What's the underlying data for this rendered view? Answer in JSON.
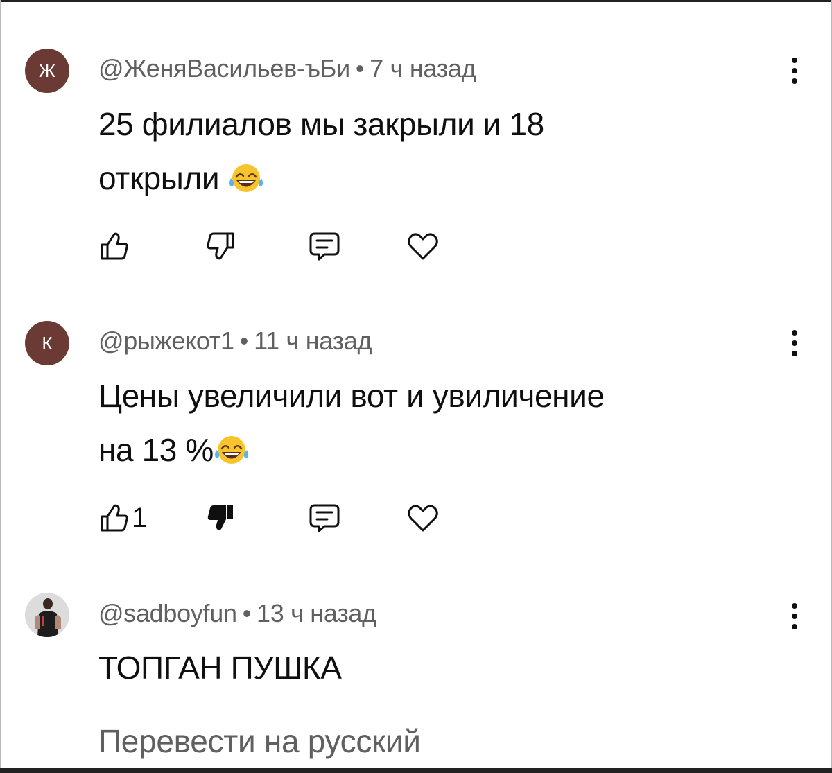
{
  "comments": [
    {
      "avatar_letter": "Ж",
      "avatar_color": "#6b3a34",
      "author": "@ЖеняВасильев-ъБи",
      "separator": "•",
      "time": "7 ч назад",
      "text_line1": "25 филиалов мы закрыли и 18",
      "text_line2": "открыли",
      "text_emoji": "face-with-tears-of-joy-icon",
      "likes": "",
      "dislike_state": "outline"
    },
    {
      "avatar_letter": "К",
      "avatar_color": "#6b3a34",
      "author": "@рыжекот1",
      "separator": "•",
      "time": "11 ч назад",
      "text_line1": "Цены увеличили вот и увиличение",
      "text_line2": "на 13 %",
      "text_emoji": "face-with-tears-of-joy-icon",
      "likes": "1",
      "dislike_state": "filled"
    },
    {
      "avatar_letter": "",
      "avatar_color": "#e6e6e6",
      "author": "@sadboyfun",
      "separator": "•",
      "time": "13 ч назад",
      "text_line1": "ТОПГАН ПУШКА",
      "translate_label": "Перевести на русский"
    }
  ],
  "icons": {
    "like": "thumbs-up-icon",
    "dislike": "thumbs-down-icon",
    "reply": "reply-bubble-icon",
    "heart": "heart-icon",
    "more": "more-vertical-icon"
  },
  "colors": {
    "text": "#0f0f0f",
    "meta": "#606060",
    "emoji_face": "#f7c52b"
  }
}
